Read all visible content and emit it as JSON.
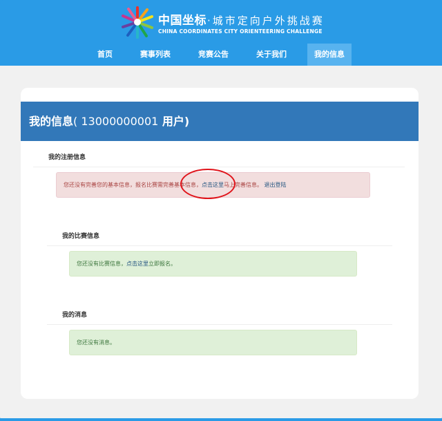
{
  "brand": {
    "logo_cn_main": "中国坐标",
    "logo_cn_sub": "·城市定向户外挑战赛",
    "logo_en": "CHINA COORDINATES CITY ORIENTEERING CHALLENGE",
    "colors": {
      "header": "#2a9be6",
      "title_bar": "#3278b9",
      "nav_active": "#58b3ef"
    }
  },
  "nav": {
    "items": [
      {
        "label": "首页"
      },
      {
        "label": "赛事列表"
      },
      {
        "label": "竞赛公告"
      },
      {
        "label": "关于我们"
      },
      {
        "label": "我的信息"
      }
    ],
    "active": "我的信息"
  },
  "page": {
    "title": "我的信息",
    "title_paren_open": "( ",
    "user_id": "13000000001",
    "user_suffix": " 用户)"
  },
  "sections": {
    "registration": {
      "title": "我的注册信息",
      "alert_text": "您还没有完善您的基本信息，报名比赛需完善基本信息，",
      "link_complete": "点击这里",
      "alert_after_link": "马上完善信息。",
      "link_logout": "退出登陆"
    },
    "competition": {
      "title": "我的比赛信息",
      "alert_text": "您还没有比赛信息，",
      "link_signup": "点击这里",
      "alert_after_link": "立即报名。"
    },
    "messages": {
      "title": "我的消息",
      "alert_text": "您还没有消息。"
    }
  },
  "annotation": {
    "type": "red-circle",
    "color": "#e0141b"
  }
}
